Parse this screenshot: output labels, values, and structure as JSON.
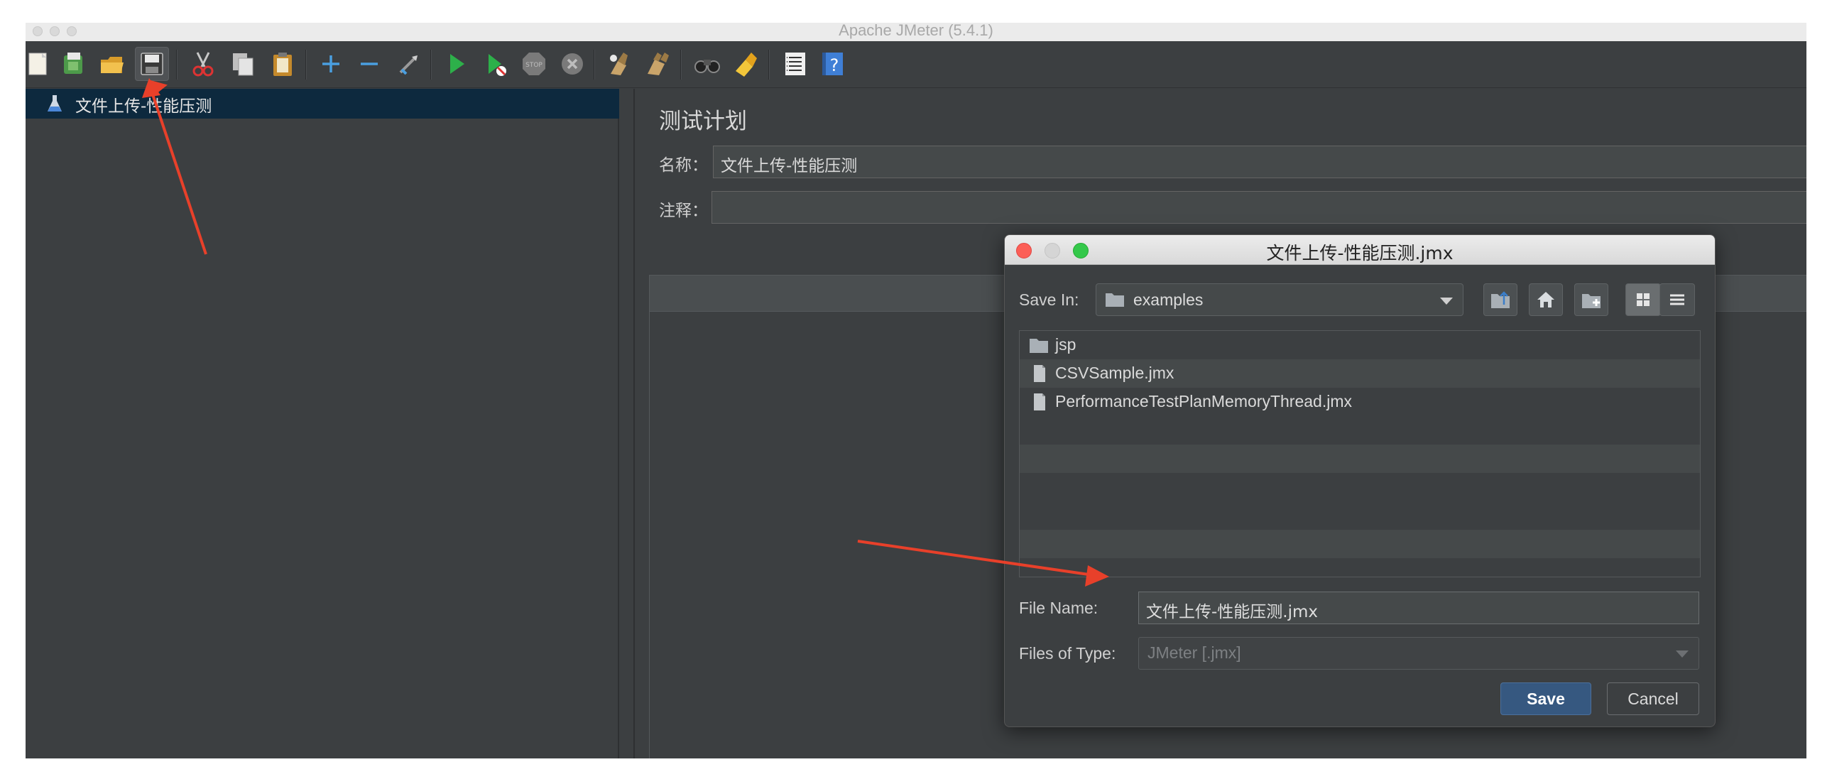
{
  "window": {
    "title": "Apache JMeter (5.4.1)"
  },
  "toolbar": {
    "buttons": [
      {
        "icon": "new-icon"
      },
      {
        "icon": "templates-icon"
      },
      {
        "icon": "open-icon"
      },
      {
        "icon": "save-icon",
        "active": true
      },
      {
        "icon": "cut-icon"
      },
      {
        "icon": "copy-icon"
      },
      {
        "icon": "paste-icon"
      },
      {
        "icon": "expand-icon"
      },
      {
        "icon": "collapse-icon"
      },
      {
        "icon": "toggle-icon"
      },
      {
        "icon": "start-icon"
      },
      {
        "icon": "start-no-pauses-icon"
      },
      {
        "icon": "stop-icon"
      },
      {
        "icon": "shutdown-icon"
      },
      {
        "icon": "clear-icon"
      },
      {
        "icon": "clear-all-icon"
      },
      {
        "icon": "search-icon"
      },
      {
        "icon": "reset-search-icon"
      },
      {
        "icon": "function-helper-icon"
      },
      {
        "icon": "help-icon"
      }
    ]
  },
  "tree": {
    "items": [
      {
        "label": "文件上传-性能压测",
        "icon": "flask-icon",
        "selected": true
      }
    ]
  },
  "testplan": {
    "heading": "测试计划",
    "name_label": "名称：",
    "name_value": "文件上传-性能压测",
    "comment_label": "注释：",
    "comment_value": ""
  },
  "dialog": {
    "title": "文件上传-性能压测.jmx",
    "save_in_label": "Save In:",
    "save_in_value": "examples",
    "files": [
      {
        "name": "jsp",
        "type": "folder"
      },
      {
        "name": "CSVSample.jmx",
        "type": "file"
      },
      {
        "name": "PerformanceTestPlanMemoryThread.jmx",
        "type": "file"
      }
    ],
    "file_name_label": "File Name:",
    "file_name_value": "文件上传-性能压测.jmx",
    "file_type_label": "Files of Type:",
    "file_type_value": "JMeter [.jmx]",
    "save_label": "Save",
    "cancel_label": "Cancel",
    "view_mode": "list"
  },
  "colors": {
    "background": "#3c3f41",
    "selection": "#0d293e",
    "save_button": "#365880",
    "annotation_arrow": "#e8402a"
  }
}
